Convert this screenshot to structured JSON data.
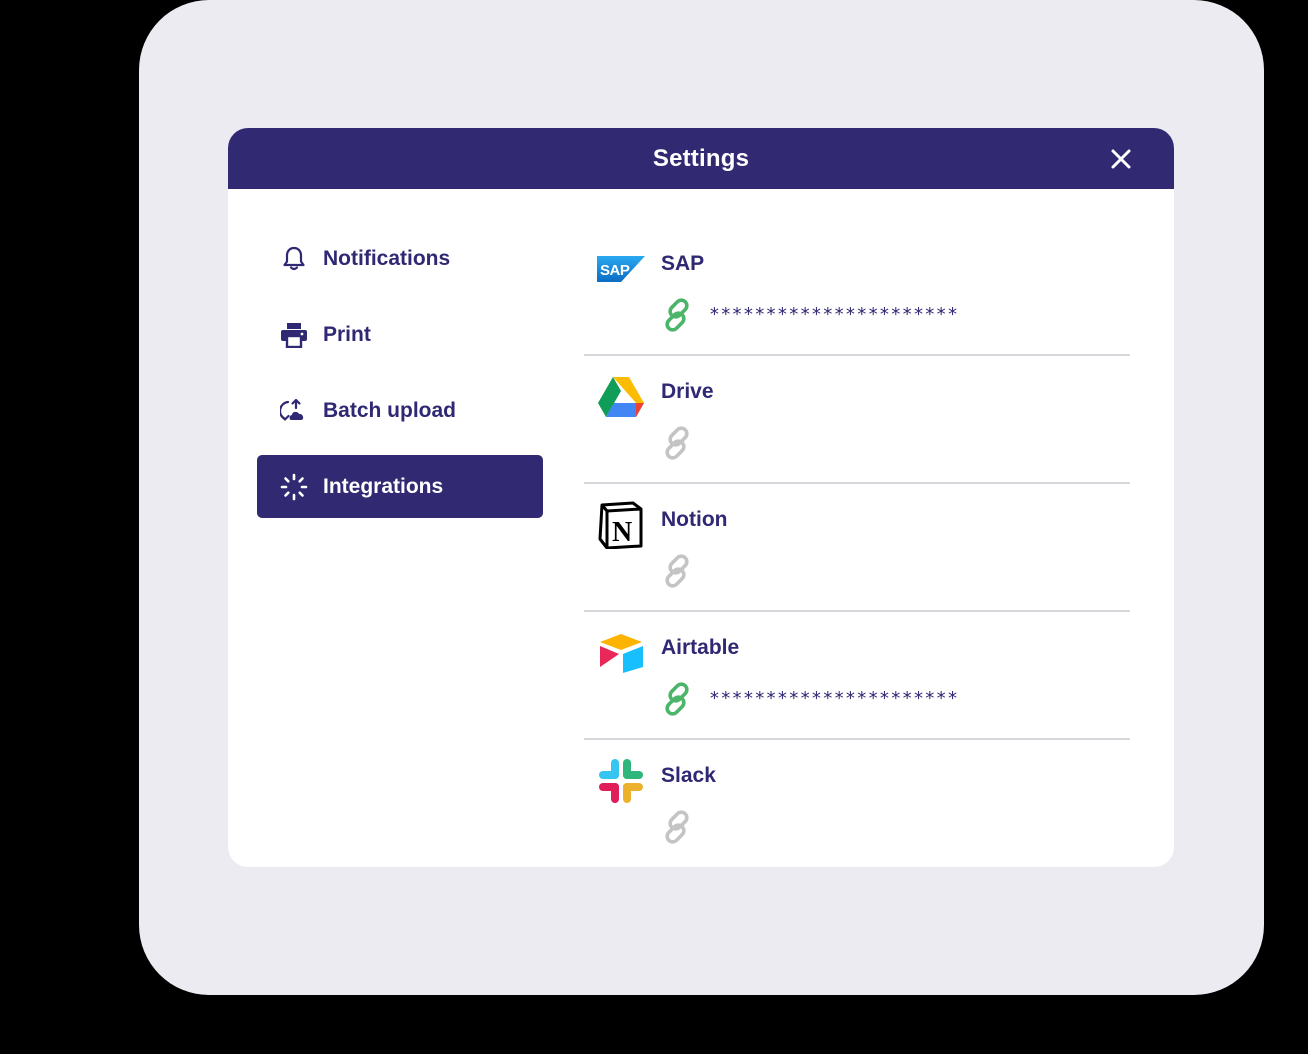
{
  "dialog": {
    "title": "Settings",
    "close_icon": "close-icon"
  },
  "sidebar": {
    "items": [
      {
        "label": "Notifications",
        "icon": "bell-icon",
        "active": false
      },
      {
        "label": "Print",
        "icon": "printer-icon",
        "active": false
      },
      {
        "label": "Batch upload",
        "icon": "batch-upload-icon",
        "active": false
      },
      {
        "label": "Integrations",
        "icon": "integrations-icon",
        "active": true
      }
    ]
  },
  "integrations": [
    {
      "name": "SAP",
      "logo": "sap-logo",
      "connected": true,
      "key": "**********************"
    },
    {
      "name": "Drive",
      "logo": "google-drive-logo",
      "connected": false,
      "key": ""
    },
    {
      "name": "Notion",
      "logo": "notion-logo",
      "connected": false,
      "key": ""
    },
    {
      "name": "Airtable",
      "logo": "airtable-logo",
      "connected": true,
      "key": "**********************"
    },
    {
      "name": "Slack",
      "logo": "slack-logo",
      "connected": false,
      "key": ""
    }
  ],
  "colors": {
    "primary": "#312a72",
    "text": "#2f2873",
    "backdrop": "#ebebf1",
    "link_connected": "#4cb56a",
    "link_disconnected": "#c4c4c4",
    "divider": "#d6d6dc"
  }
}
